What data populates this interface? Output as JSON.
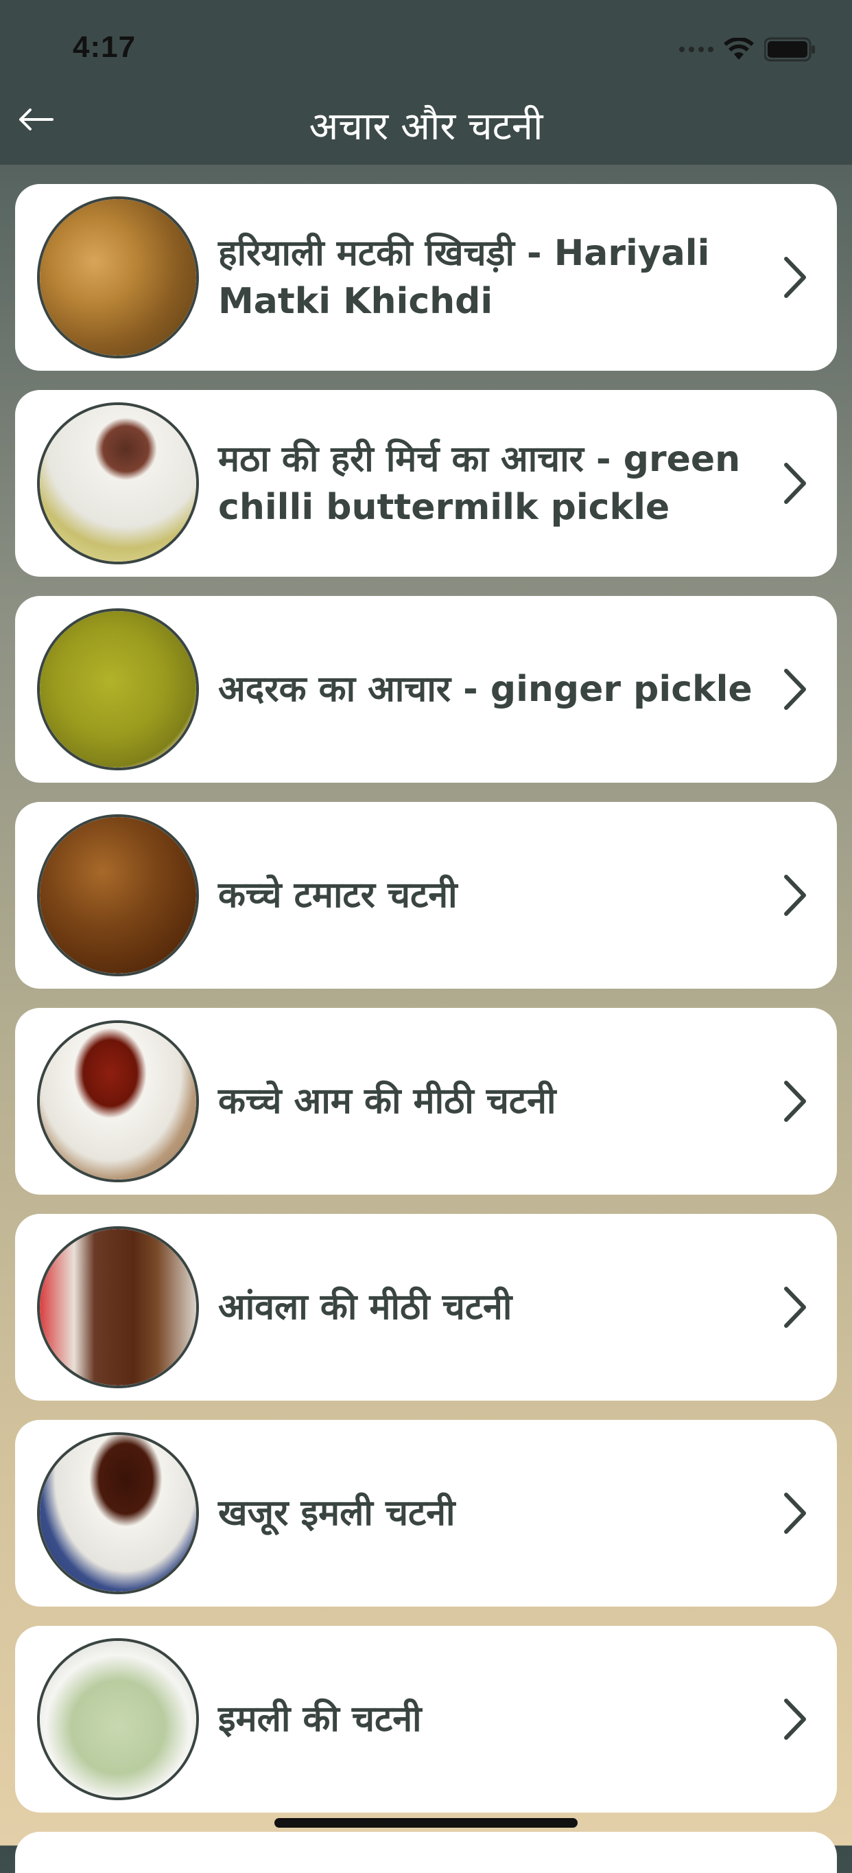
{
  "status_bar": {
    "time": "4:17"
  },
  "nav": {
    "title": "अचार और चटनी"
  },
  "items": [
    {
      "title": "हरियाली मटकी खिचड़ी - Hariyali Matki Khichdi",
      "thumb": "pickled-chilies"
    },
    {
      "title": "मठा की हरी मिर्च का आचार - green chilli buttermilk pickle",
      "thumb": "ginger-lemon-plate"
    },
    {
      "title": "अदरक का आचार - ginger pickle",
      "thumb": "green-chutney"
    },
    {
      "title": "कच्चे  टमाटर चटनी",
      "thumb": "tomato-chutney"
    },
    {
      "title": "कच्चे आम की मीठी चटनी",
      "thumb": "mango-chutney-bowl"
    },
    {
      "title": "आंवला की मीठी चटनी",
      "thumb": "amla-chutney-jar"
    },
    {
      "title": "खजूर इमली चटनी",
      "thumb": "date-tamarind-cup"
    },
    {
      "title": "इमली की  चटनी",
      "thumb": "tamarind-chutney-bowl"
    }
  ],
  "colors": {
    "header_bg": "#3c4a49",
    "card_bg": "#ffffff",
    "text": "#3a4542"
  }
}
